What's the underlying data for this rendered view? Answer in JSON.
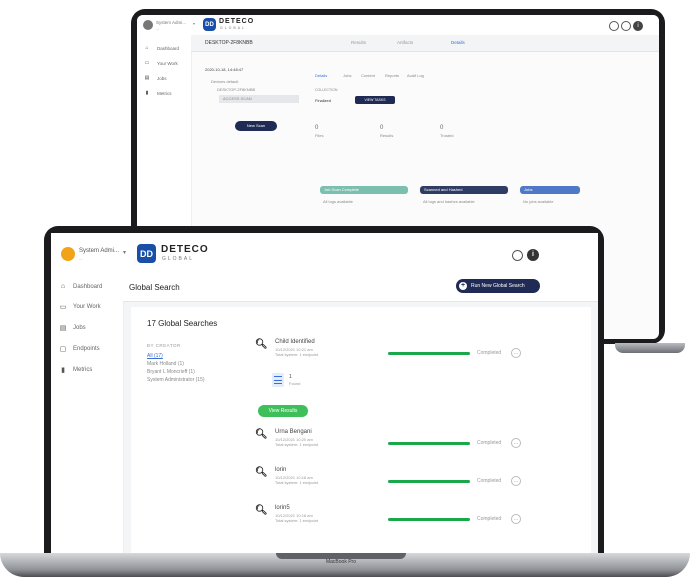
{
  "back": {
    "user": {
      "name": "System Admi...",
      "role": "...",
      "menu_arrow": "▾"
    },
    "brand": {
      "mark": "DD",
      "name": "DETECO",
      "sub": "GLOBAL"
    },
    "header_icons": [
      "gear-icon",
      "info-icon"
    ],
    "sidebar": [
      {
        "label": "Dashboard",
        "icon": "home-icon"
      },
      {
        "label": "Your Work",
        "icon": "briefcase-icon"
      },
      {
        "label": "Jobs",
        "icon": "jobs-icon"
      },
      {
        "label": "Metrics",
        "icon": "chart-icon"
      }
    ],
    "device_name": "DESKTOP-2F8KNBB",
    "tabs": [
      "Results",
      "Artifacts",
      "Details"
    ],
    "timestamp": "2020-10-18, 14:48:47",
    "tree": [
      "Devices default",
      "DESKTOP-2F8KNBB",
      "ACCESS SCAN"
    ],
    "new_scan_btn": "New Scan",
    "subtabs": [
      "Details",
      "Jobs",
      "Content",
      "Reports",
      "Audit Log"
    ],
    "collection_label": "COLLECTION",
    "status_label": "Finalized",
    "view_tasks_btn": "VIEW TASKS",
    "stats": [
      {
        "value": "0",
        "label": "Files"
      },
      {
        "value": "0",
        "label": "Results"
      },
      {
        "value": "0",
        "label": "Trusted"
      }
    ],
    "cards": [
      {
        "title": "Job Scan Complete",
        "body": "All logs available",
        "color": "#7bbfae"
      },
      {
        "title": "Scanned and Hashed",
        "body": "All logs and hashes available",
        "color": "#2f3c63"
      },
      {
        "title": "Jobs",
        "body": "No jobs available",
        "color": "#4f79c7"
      }
    ]
  },
  "front": {
    "user": {
      "name": "System Admi...",
      "role": "...",
      "menu_arrow": "▾"
    },
    "brand": {
      "mark": "DD",
      "name": "DETECO",
      "sub": "GLOBAL"
    },
    "sidebar": [
      {
        "label": "Dashboard",
        "icon": "home-icon"
      },
      {
        "label": "Your Work",
        "icon": "briefcase-icon"
      },
      {
        "label": "Jobs",
        "icon": "jobs-icon"
      },
      {
        "label": "Endpoints",
        "icon": "monitor-icon"
      },
      {
        "label": "Metrics",
        "icon": "chart-icon"
      }
    ],
    "page_title": "Global Search",
    "run_button": "Run New Global Search",
    "count_heading": "17 Global Searches",
    "filter_heading": "BY CREATOR",
    "filters": [
      "All (17)",
      "Mark Holland (1)",
      "Bryant L Moncrieff (1)",
      "System Administrator (15)"
    ],
    "results": [
      {
        "title": "Child Identified",
        "meta1": "10/12/2021 10:21 am",
        "meta2": "Total system: 1 endpoint",
        "status": "Completed",
        "progress": 1
      },
      {
        "title": "Urna Bengani",
        "meta1": "10/12/2021 10:20 am",
        "meta2": "Total system: 1 endpoint",
        "status": "Completed",
        "progress": 1
      },
      {
        "title": "lorin",
        "meta1": "10/12/2021 10:18 am",
        "meta2": "Total system: 1 endpoint",
        "status": "Completed",
        "progress": 1
      },
      {
        "title": "lorin5",
        "meta1": "10/12/2021 10:16 am",
        "meta2": "Total system: 1 endpoint",
        "status": "Completed",
        "progress": 1
      }
    ],
    "found": {
      "count": "1",
      "label": "Found"
    },
    "view_results_btn": "View Results",
    "more_btn": "…"
  },
  "laptop_label": "MacBook Pro",
  "colors": {
    "brand": "#1a4fa8",
    "success": "#1aa84b",
    "primary_dark": "#1f2b55"
  }
}
